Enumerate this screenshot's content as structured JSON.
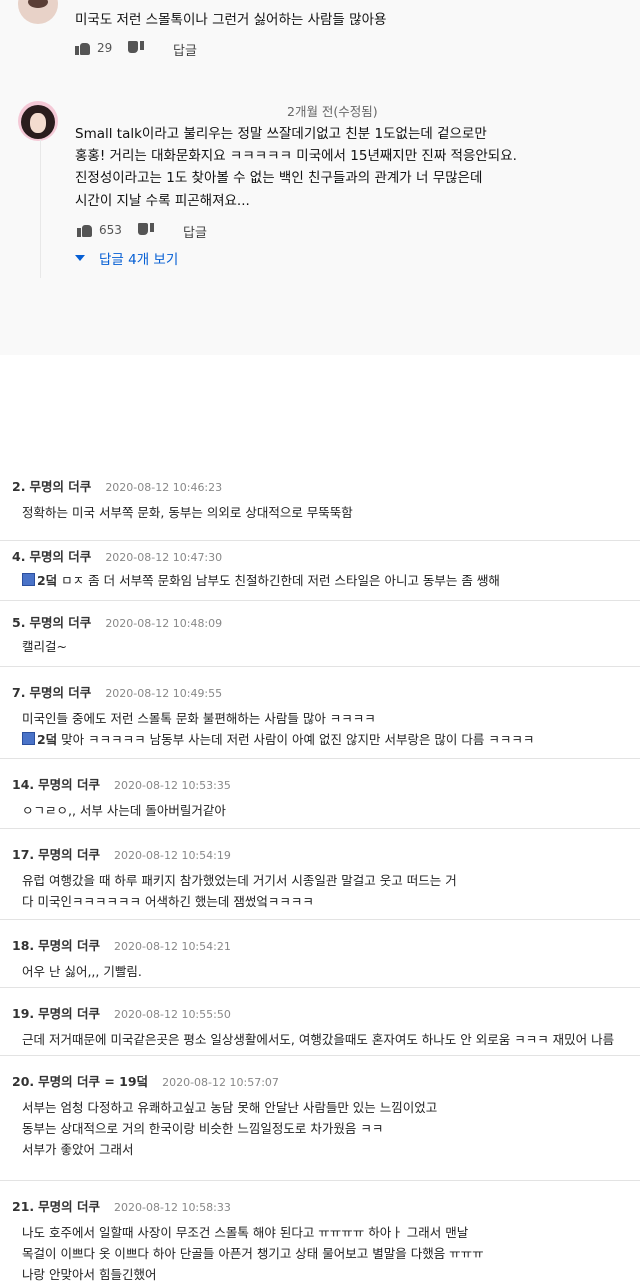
{
  "youtube": {
    "comment1": {
      "text": "미국도 저런 스몰톡이나 그런거 싫어하는 사람들 많아용",
      "likes": "29",
      "reply_label": "답글"
    },
    "comment2": {
      "time": "2개월 전(수정됨)",
      "lines": [
        "Small talk이라고 불리우는 정말 쓰잘데기없고 친분 1도없는데 겉으로만",
        "홍홍! 거리는 대화문화지요 ㅋㅋㅋㅋㅋ 미국에서 15년째지만 진짜 적응안되요.",
        "진정성이라고는 1도 찾아볼 수 없는 백인 친구들과의 관계가 너 무많은데",
        "시간이 지날 수록 피곤해져요..."
      ],
      "likes": "653",
      "reply_label": "답글",
      "view_replies": "답글 4개 보기"
    }
  },
  "posts": [
    {
      "num": "2.",
      "nick": "무명의 더쿠",
      "date": "2020-08-12 10:46:23",
      "lines": [
        {
          "text": "정확하는 미국 서부쪽 문화, 동부는 의외로 상대적으로 무뚝뚝함"
        }
      ]
    },
    {
      "num": "4.",
      "nick": "무명의 더쿠",
      "date": "2020-08-12 10:47:30",
      "lines": [
        {
          "ref": "2덬",
          "text": " ㅁㅈ 좀 더 서부쪽 문화임 남부도 친절하긴한데 저런 스타일은 아니고 동부는 좀 쌩해"
        }
      ]
    },
    {
      "num": "5.",
      "nick": "무명의 더쿠",
      "date": "2020-08-12 10:48:09",
      "lines": [
        {
          "text": "캘리걸~"
        }
      ]
    },
    {
      "num": "7.",
      "nick": "무명의 더쿠",
      "date": "2020-08-12 10:49:55",
      "lines": [
        {
          "text": "미국인들 중에도 저런 스몰톡 문화 불편해하는 사람들 많아 ㅋㅋㅋㅋ"
        },
        {
          "ref": "2덬",
          "text": " 맞아 ㅋㅋㅋㅋㅋ 남동부 사는데 저런 사람이 아예 없진 않지만 서부랑은 많이 다름 ㅋㅋㅋㅋ"
        }
      ]
    },
    {
      "num": "14.",
      "nick": "무명의 더쿠",
      "date": "2020-08-12 10:53:35",
      "lines": [
        {
          "text": "ㅇㄱㄹㅇ,, 서부 사는데 돌아버릴거같아"
        }
      ]
    },
    {
      "num": "17.",
      "nick": "무명의 더쿠",
      "date": "2020-08-12 10:54:19",
      "lines": [
        {
          "text": "유럽 여행갔을 때 하루 패키지 참가했었는데 거기서 시종일관 말걸고 웃고 떠드는 거"
        },
        {
          "text": "다 미국인ㅋㅋㅋㅋㅋㅋ 어색하긴 했는데 잼썼엌ㅋㅋㅋㅋ"
        }
      ]
    },
    {
      "num": "18.",
      "nick": "무명의 더쿠",
      "date": "2020-08-12 10:54:21",
      "lines": [
        {
          "text": "어우 난 싫어,,, 기빨림."
        }
      ]
    },
    {
      "num": "19.",
      "nick": "무명의 더쿠",
      "date": "2020-08-12 10:55:50",
      "lines": [
        {
          "text": "근데 저거때문에 미국같은곳은 평소 일상생활에서도, 여행갔을때도 혼자여도 하나도 안 외로움 ㅋㅋㅋ 재밌어 나름"
        }
      ]
    },
    {
      "num": "20.",
      "nick": "무명의 더쿠 = 19덬",
      "date": "2020-08-12 10:57:07",
      "lines": [
        {
          "text": "서부는 엄청 다정하고 유쾌하고싶고 농담 못해 안달난 사람들만 있는 느낌이었고"
        },
        {
          "text": "동부는 상대적으로 거의 한국이랑 비슷한 느낌일정도로 차가웠음 ㅋㅋ"
        },
        {
          "text": "서부가 좋았어 그래서"
        }
      ]
    },
    {
      "num": "21.",
      "nick": "무명의 더쿠",
      "date": "2020-08-12 10:58:33",
      "lines": [
        {
          "text": "나도 호주에서 일할때 사장이 무조건 스몰톡 해야 된다고 ㅠㅠㅠㅠ 하아ㅏ 그래서 맨날"
        },
        {
          "text": "목걸이 이쁘다 옷 이쁘다 하아 단골들 아픈거 챙기고 상태 물어보고 별말을 다했음 ㅠㅠㅠ"
        },
        {
          "text": "나랑 안맞아서 힘들긴했어"
        }
      ]
    }
  ]
}
